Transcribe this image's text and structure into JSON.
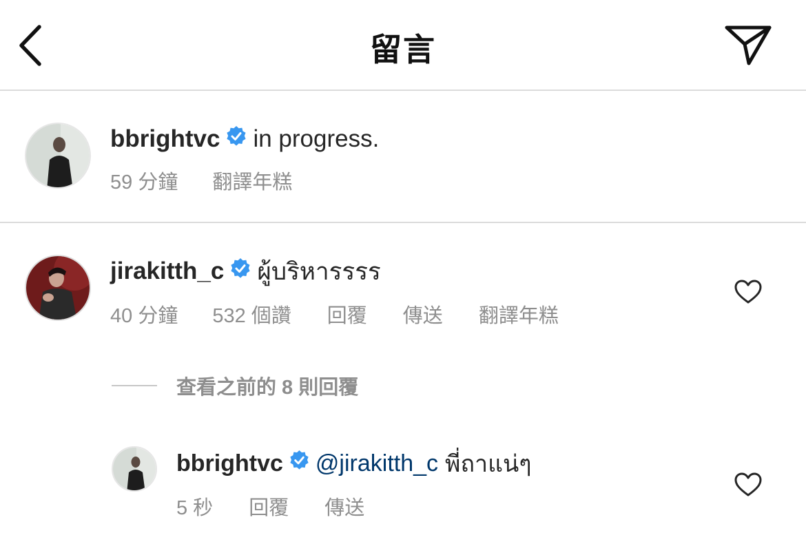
{
  "header": {
    "title": "留言"
  },
  "caption": {
    "username": "bbrightvc",
    "text": "in progress.",
    "time": "59 分鐘",
    "translate": "翻譯年糕"
  },
  "comment": {
    "username": "jirakitth_c",
    "text": "ผู้บริหารรรร",
    "time": "40 分鐘",
    "likes": "532 個讚",
    "reply": "回覆",
    "send": "傳送",
    "translate": "翻譯年糕"
  },
  "view_replies": {
    "label": "查看之前的 8 則回覆"
  },
  "reply": {
    "username": "bbrightvc",
    "mention": "@jirakitth_c",
    "text": "พี่ถาแน่ๆ",
    "time": "5 秒",
    "reply": "回覆",
    "send": "傳送"
  },
  "colors": {
    "verified": "#3897f0",
    "mention": "#00376b",
    "meta": "#8e8e8e",
    "divider": "#dbdbdb"
  },
  "icons": {
    "back": "chevron-left-icon",
    "send": "paper-plane-icon",
    "verified": "verified-badge-icon",
    "like": "heart-outline-icon"
  }
}
